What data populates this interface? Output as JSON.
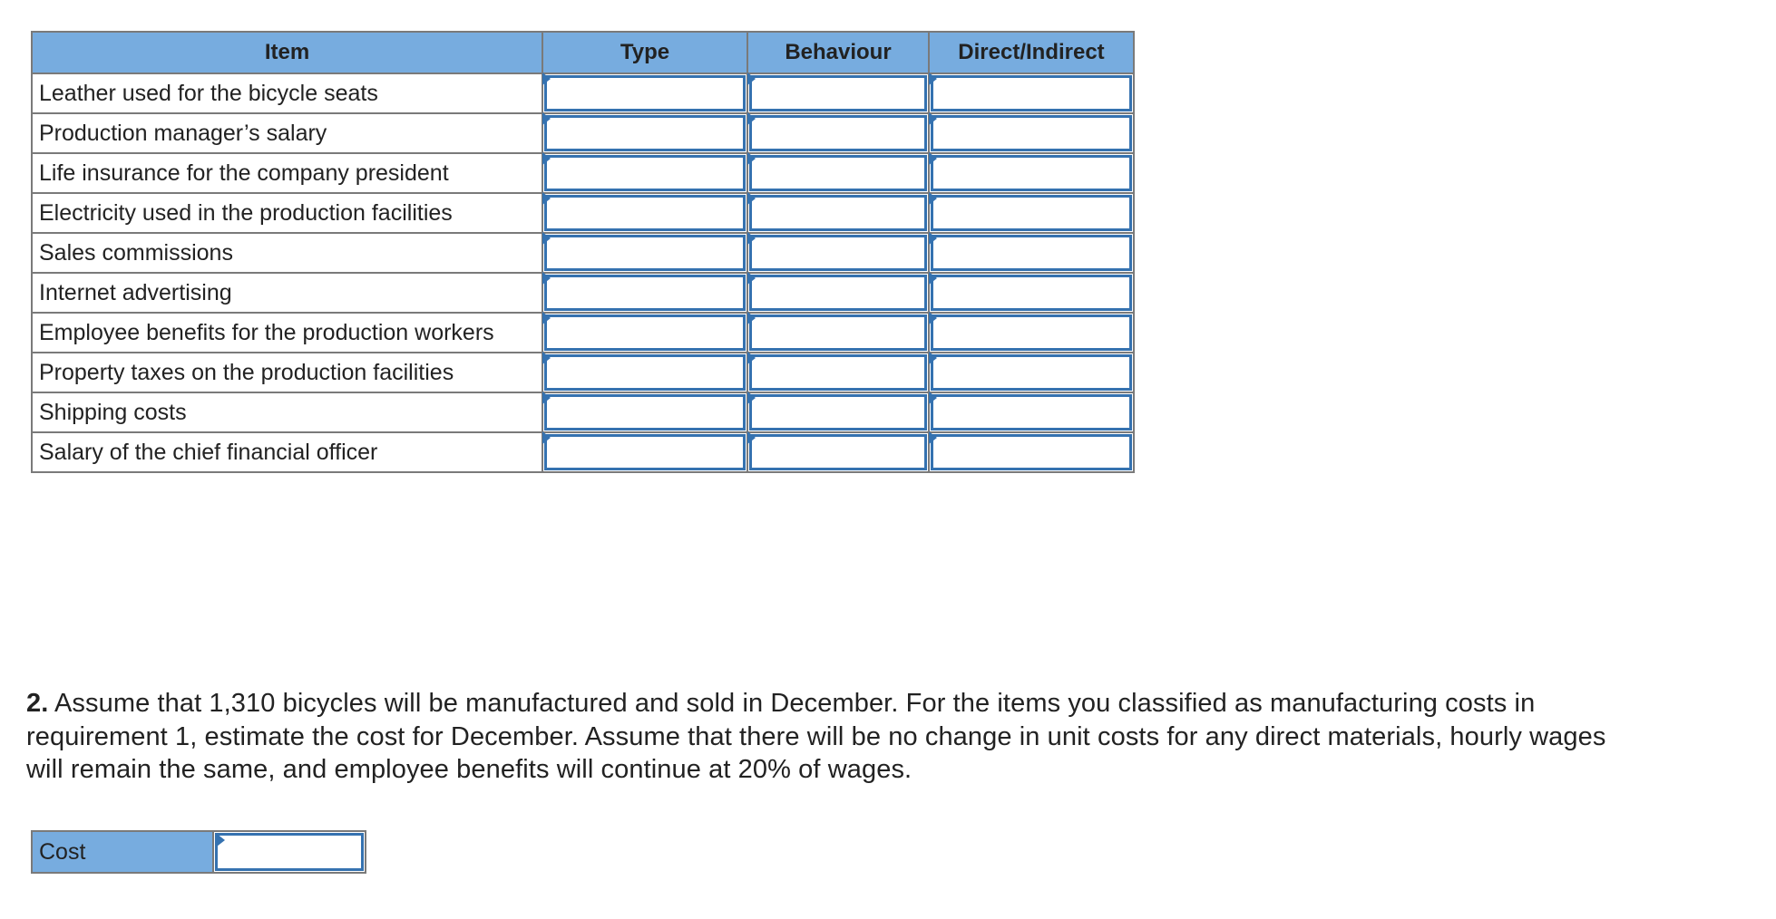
{
  "classification_table": {
    "headers": {
      "item": "Item",
      "type": "Type",
      "behaviour": "Behaviour",
      "direct_indirect": "Direct/Indirect"
    },
    "rows": [
      {
        "item": "Leather used for the bicycle seats",
        "type": "",
        "behaviour": "",
        "direct_indirect": ""
      },
      {
        "item": "Production manager’s salary",
        "type": "",
        "behaviour": "",
        "direct_indirect": ""
      },
      {
        "item": "Life insurance for the company president",
        "type": "",
        "behaviour": "",
        "direct_indirect": ""
      },
      {
        "item": "Electricity used in the production facilities",
        "type": "",
        "behaviour": "",
        "direct_indirect": ""
      },
      {
        "item": "Sales commissions",
        "type": "",
        "behaviour": "",
        "direct_indirect": ""
      },
      {
        "item": "Internet advertising",
        "type": "",
        "behaviour": "",
        "direct_indirect": ""
      },
      {
        "item": "Employee benefits for the production workers",
        "type": "",
        "behaviour": "",
        "direct_indirect": ""
      },
      {
        "item": "Property taxes on the production facilities",
        "type": "",
        "behaviour": "",
        "direct_indirect": ""
      },
      {
        "item": "Shipping costs",
        "type": "",
        "behaviour": "",
        "direct_indirect": ""
      },
      {
        "item": "Salary of the chief financial officer",
        "type": "",
        "behaviour": "",
        "direct_indirect": ""
      }
    ]
  },
  "question": {
    "number": "2.",
    "lines": [
      " Assume that 1,310 bicycles will be manufactured and sold in December. For the items you classified as manufacturing costs in",
      "requirement 1, estimate the cost for December. Assume that there will be no change in unit costs for any direct materials, hourly wages",
      "will remain the same, and employee benefits will continue at 20% of wages."
    ]
  },
  "cost_input": {
    "label": "Cost",
    "value": ""
  },
  "icons": {
    "dropdown_marker": "triangle-right-marker"
  },
  "colors": {
    "header_bg": "#77acdf",
    "input_border": "#3572b0",
    "grid_border": "#7a7a7a",
    "text": "#222222"
  }
}
